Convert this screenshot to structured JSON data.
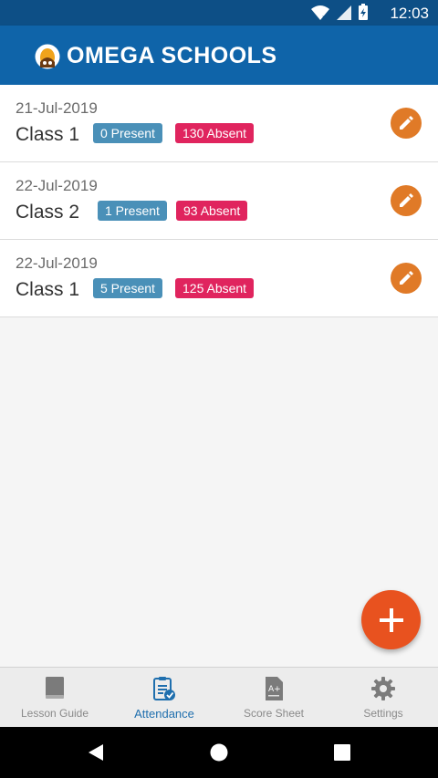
{
  "status_bar": {
    "time": "12:03",
    "icons": [
      "wifi-icon",
      "signal-icon",
      "battery-icon"
    ]
  },
  "app_bar": {
    "title": "OMEGA SCHOOLS",
    "logo_icon": "school-logo-icon"
  },
  "attendance": [
    {
      "date": "21-Jul-2019",
      "class_name": "Class 1",
      "present": "0 Present",
      "absent": "130 Absent"
    },
    {
      "date": "22-Jul-2019",
      "class_name": "Class 2",
      "present": "1 Present",
      "absent": "93 Absent"
    },
    {
      "date": "22-Jul-2019",
      "class_name": "Class 1",
      "present": "5 Present",
      "absent": "125 Absent"
    }
  ],
  "fab": {
    "icon": "plus-icon"
  },
  "bottom_nav": [
    {
      "label": "Lesson Guide",
      "icon": "book-icon"
    },
    {
      "label": "Attendance",
      "icon": "clipboard-check-icon",
      "active": true
    },
    {
      "label": "Score Sheet",
      "icon": "score-sheet-icon"
    },
    {
      "label": "Settings",
      "icon": "gear-icon"
    }
  ],
  "colors": {
    "primary": "#0f64a9",
    "present": "#4a90b8",
    "absent": "#e0245e",
    "edit": "#e07a27",
    "fab": "#e8521f"
  }
}
